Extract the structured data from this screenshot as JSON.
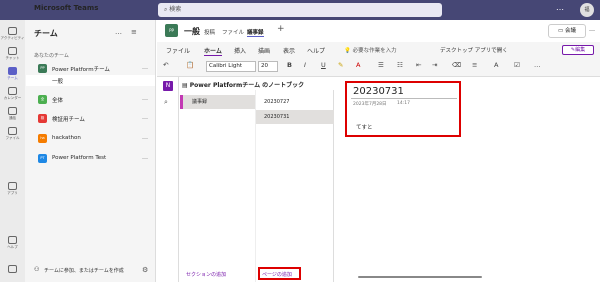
{
  "app": {
    "title": "Microsoft Teams",
    "search_placeholder": "検索",
    "avatar": "福"
  },
  "rail": [
    {
      "label": "アクティビティ",
      "icon": "bell-icon"
    },
    {
      "label": "チャット",
      "icon": "chat-icon"
    },
    {
      "label": "チーム",
      "icon": "teams-icon"
    },
    {
      "label": "カレンダー",
      "icon": "calendar-icon"
    },
    {
      "label": "通話",
      "icon": "call-icon"
    },
    {
      "label": "ファイル",
      "icon": "file-icon"
    },
    {
      "label": "アプリ",
      "icon": "apps-icon"
    },
    {
      "label": "ヘルプ",
      "icon": "help-icon"
    },
    {
      "label": "",
      "icon": "download-icon"
    }
  ],
  "teams_panel": {
    "title": "チーム",
    "section": "あなたのチーム",
    "teams": [
      {
        "name": "Power Platformチーム",
        "abbr": "PP",
        "color": "#3b7a57"
      },
      {
        "name": "全体",
        "abbr": "全",
        "color": "#4caf50"
      },
      {
        "name": "検証用チーム",
        "abbr": "検",
        "color": "#e53935"
      },
      {
        "name": "hackathon",
        "abbr": "ha",
        "color": "#f57c00"
      },
      {
        "name": "Power Platform Test",
        "abbr": "PT",
        "color": "#1e88e5"
      }
    ],
    "selected_channel": "一般",
    "join_text": "チームに参加、またはチームを作成"
  },
  "channel": {
    "avatar": "PP",
    "name": "一般",
    "tabs": [
      "投稿",
      "ファイル",
      "議事録"
    ],
    "add": "+",
    "meet": "会議"
  },
  "ribbon": {
    "tabs": [
      "ファイル",
      "ホーム",
      "挿入",
      "描画",
      "表示",
      "ヘルプ"
    ],
    "tell_me": "必要な作業を入力",
    "desktop": "デスクトップ アプリで開く",
    "edit": "編集"
  },
  "toolbar": {
    "font": "Calibri Light",
    "size": "20",
    "bold": "B",
    "italic": "I",
    "underline": "U"
  },
  "notebook": {
    "title": "Power Platformチーム のノートブック",
    "sections": [
      "議事録"
    ],
    "pages": [
      "20230727",
      "20230731"
    ],
    "add_section": "セクションの追加",
    "add_page": "ページの追加"
  },
  "note": {
    "title": "20230731",
    "date": "2023年7月28日",
    "time": "14:17",
    "body": "てすと"
  }
}
